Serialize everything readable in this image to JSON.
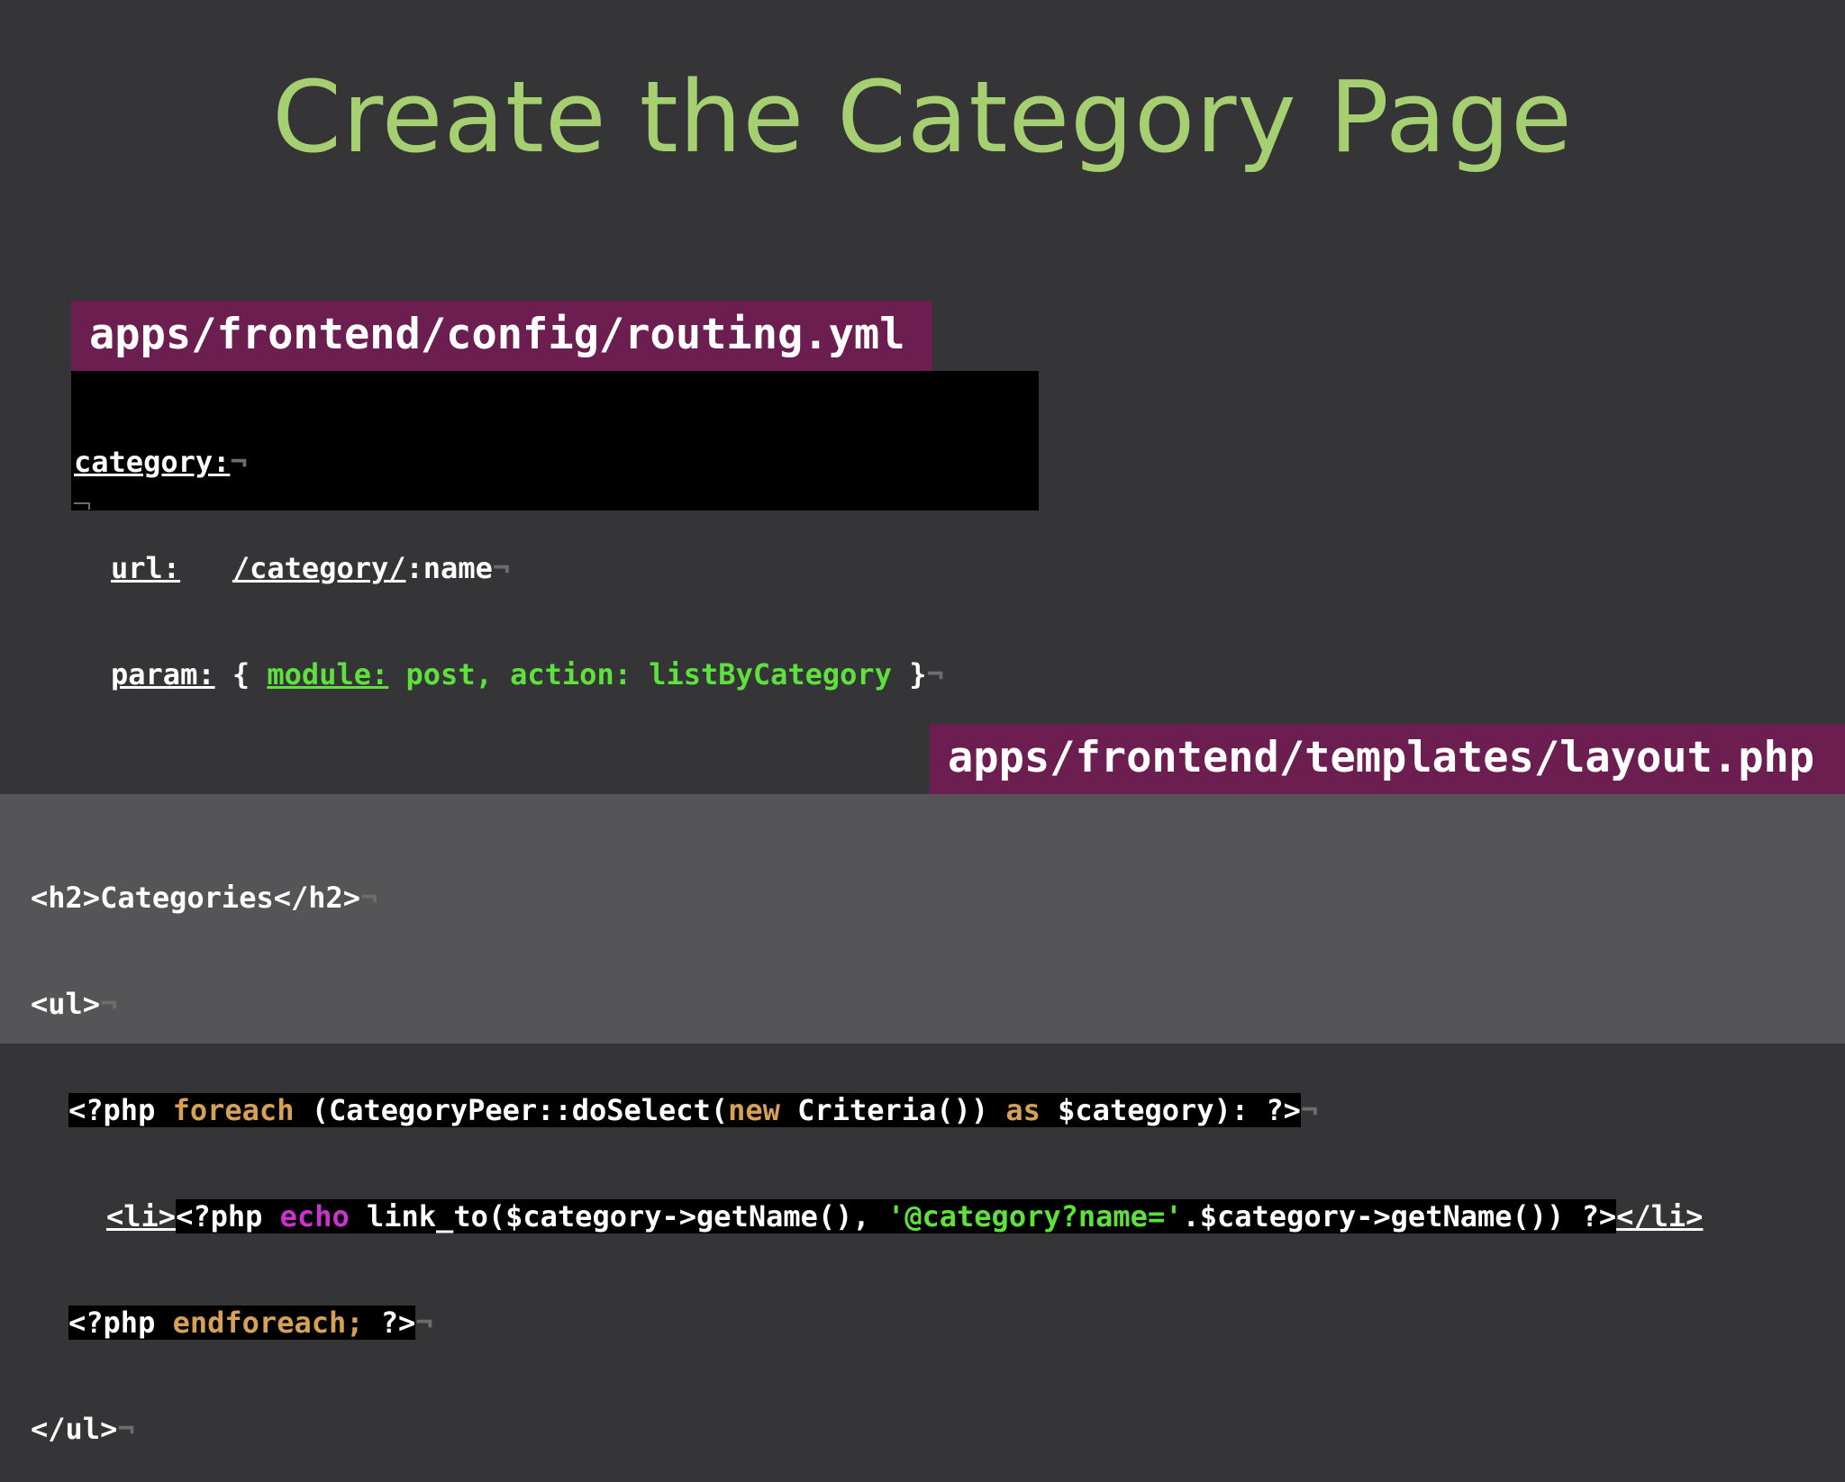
{
  "slide": {
    "title": "Create the Category Page"
  },
  "routing_block": {
    "file_label": "apps/frontend/config/routing.yml",
    "lines": {
      "category_key": "category:",
      "url_key": "url:",
      "url_value": "/category/",
      "url_param": ":name",
      "param_key": "param:",
      "param_open": "{",
      "module_key": "module:",
      "module_rest": "post, action: listByCategory",
      "param_close": "}"
    }
  },
  "layout_block": {
    "file_label": "apps/frontend/templates/layout.php",
    "lines": {
      "h2_open": "<h2>",
      "h2_text": "Categories",
      "h2_close": "</h2>",
      "ul_open": "<ul>",
      "php_open_1": "<?php",
      "foreach_kw": "foreach",
      "foreach_expr_1": "(CategoryPeer::doSelect(",
      "new_kw": "new",
      "foreach_expr_2": "Criteria())",
      "as_kw": "as",
      "foreach_expr_3": "$category): ?>",
      "li_open": "<li>",
      "php_open_2": "<?php",
      "echo_kw": "echo",
      "link_expr_1": "link_to($category->getName(),",
      "link_string": "'@category?name='",
      "link_expr_2": ".$category->getName()) ?>",
      "li_close": "</li>",
      "php_open_3": "<?php",
      "endforeach_kw": "endforeach;",
      "php_close_3": "?>",
      "ul_close": "</ul>"
    }
  },
  "colors": {
    "background": "#353537",
    "title": "#a6cf72",
    "label_bg": "#6d1e51",
    "code_string": "#5ee13c",
    "code_keyword_orange": "#d6a055",
    "code_keyword_magenta": "#cc33cc"
  }
}
